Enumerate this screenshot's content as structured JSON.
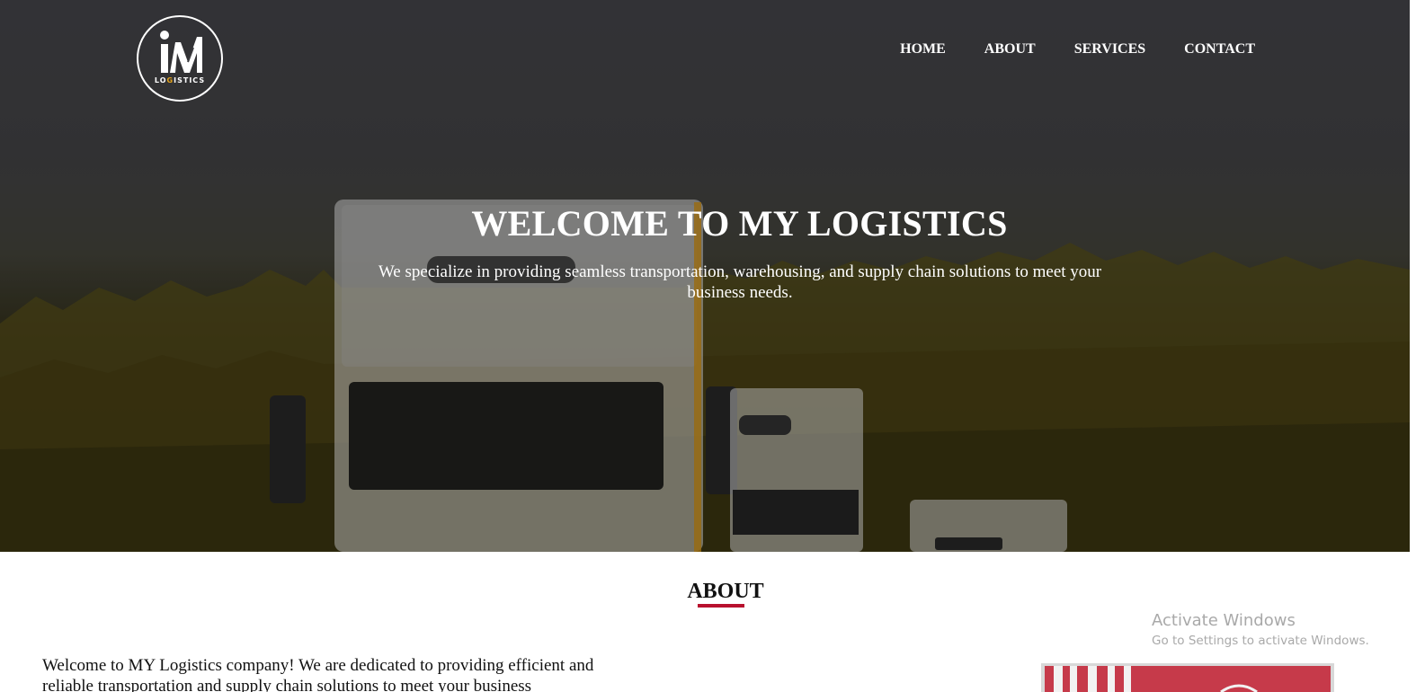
{
  "logo": {
    "word": "LOGISTICS",
    "word_prefix": "LO",
    "word_accent": "G",
    "word_suffix": "ISTICS",
    "icon": "my-logistics-logo"
  },
  "nav": {
    "items": [
      {
        "label": "HOME"
      },
      {
        "label": "ABOUT"
      },
      {
        "label": "SERVICES"
      },
      {
        "label": "CONTACT"
      }
    ]
  },
  "hero": {
    "title": "WELCOME TO MY LOGISTICS",
    "subtitle": "We specialize in providing seamless transportation, warehousing, and supply chain solutions to meet your business needs."
  },
  "about": {
    "heading": "ABOUT",
    "text": "Welcome to MY Logistics company! We are dedicated to providing efficient and reliable transportation and supply chain solutions to meet your business"
  },
  "watermark": {
    "title": "Activate Windows",
    "subtitle": "Go to Settings to activate Windows."
  },
  "colors": {
    "accent": "#b8112e",
    "logo_accent": "#e3a21a",
    "hero_text": "#ffffff"
  }
}
